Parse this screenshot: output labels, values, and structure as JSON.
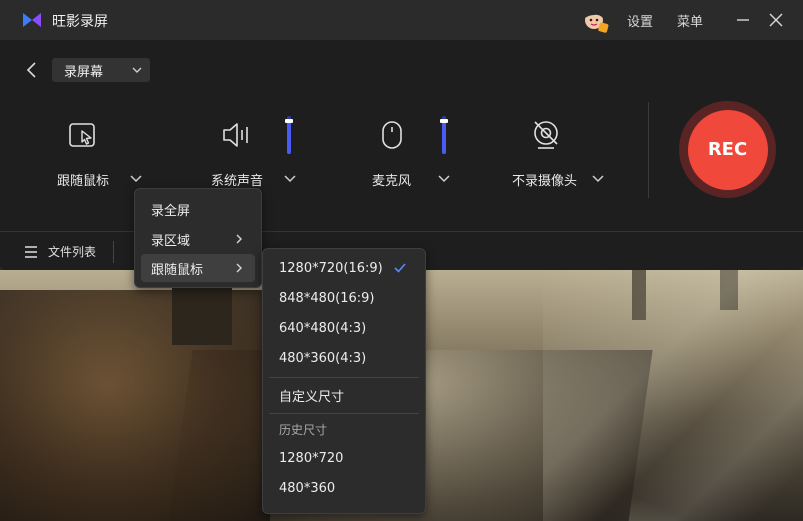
{
  "app": {
    "title": "旺影录屏",
    "settings_label": "设置",
    "menu_label": "菜单"
  },
  "toolbar": {
    "mode_value": "录屏幕"
  },
  "controls": {
    "cursor_follow": "跟随鼠标",
    "system_audio": "系统声音",
    "microphone": "麦克风",
    "no_camera": "不录摄像头",
    "system_audio_level": 0.9,
    "microphone_level": 0.9
  },
  "rec": {
    "label": "REC"
  },
  "bottom": {
    "file_list": "文件列表"
  },
  "mode_menu": {
    "items": [
      {
        "label": "录全屏"
      },
      {
        "label": "录区域"
      },
      {
        "label": "跟随鼠标"
      }
    ]
  },
  "size_menu": {
    "presets": [
      {
        "label": "1280*720(16:9)",
        "selected": true
      },
      {
        "label": "848*480(16:9)"
      },
      {
        "label": "640*480(4:3)"
      },
      {
        "label": "480*360(4:3)"
      }
    ],
    "custom": "自定义尺寸",
    "history_heading": "历史尺寸",
    "history": [
      {
        "label": "1280*720"
      },
      {
        "label": "480*360"
      }
    ]
  },
  "colors": {
    "accent": "#4a5bf5",
    "rec": "#f0483a",
    "rec_ring": "#5a2424",
    "check": "#5b8bf5"
  }
}
